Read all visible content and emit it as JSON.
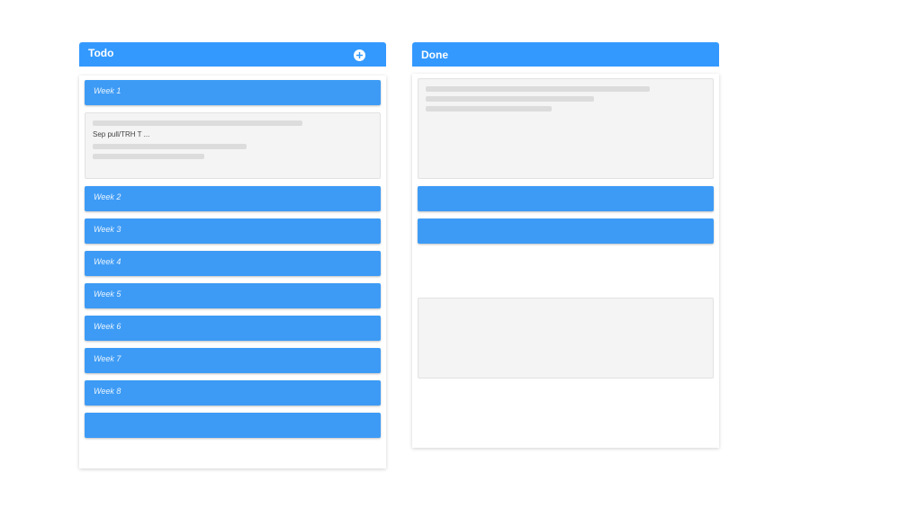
{
  "columns": {
    "todo": {
      "title": "Todo",
      "detail_text": "Sep pull/TRH T ..."
    },
    "done": {
      "title": "Done"
    }
  },
  "todo_cards": [
    "Week 1",
    "Week 2",
    "Week 3",
    "Week 4",
    "Week 5",
    "Week 6",
    "Week 7",
    "Week 8",
    ""
  ],
  "colors": {
    "header": "#3399ff",
    "card": "#3d9bf5"
  },
  "icons": {
    "add": "plus-circle-icon"
  }
}
